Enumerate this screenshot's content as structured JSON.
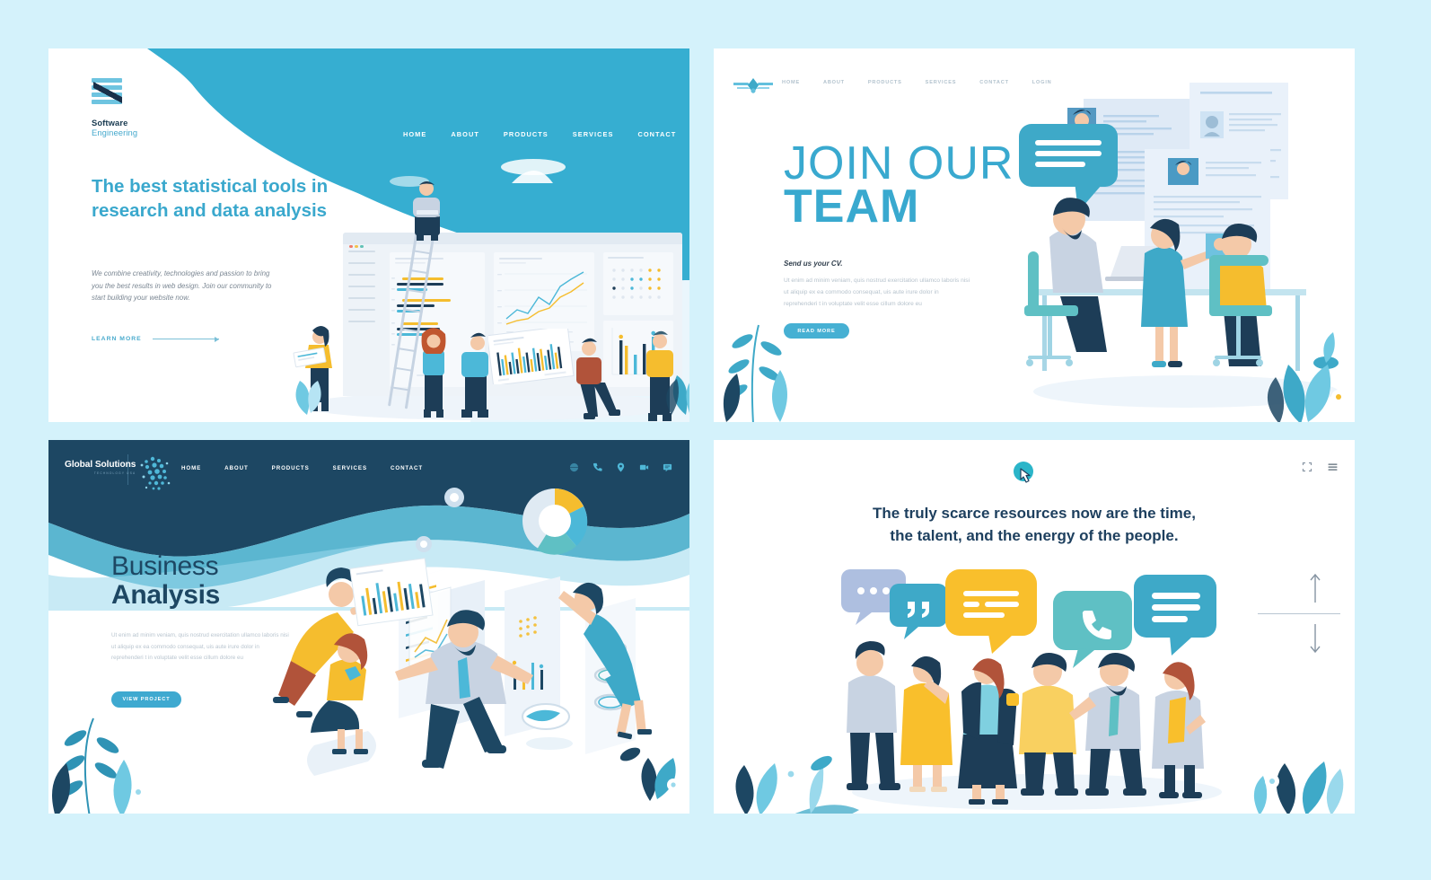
{
  "background_color": "#d4f2fb",
  "panels": [
    {
      "id": "software-engineering",
      "logo": {
        "title": "Software",
        "subtitle": "Engineering"
      },
      "nav": [
        "HOME",
        "ABOUT",
        "PRODUCTS",
        "SERVICES",
        "CONTACT"
      ],
      "menu_icon": "hamburger-icon",
      "heading": "The best statistical tools in research and data analysis",
      "body": "We combine creativity, technologies and passion to bring you the best results in web design. Join our community to start building your website now.",
      "cta": "LEARN MORE",
      "accent": "#3aa8cd",
      "hero_bg": "#36aed1"
    },
    {
      "id": "join-our-team",
      "logo": "wings-icon",
      "nav": [
        "HOME",
        "ABOUT",
        "PRODUCTS",
        "SERVICES",
        "CONTACT",
        "LOGIN"
      ],
      "heading_line1": "JOIN OUR",
      "heading_line2": "TEAM",
      "subtitle": "Send us your CV.",
      "body": "Ut enim ad minim veniam, quis nostrud exercitation ullamco laboris nisi ut aliquip ex ea commodo consequat, uis aute irure dolor in reprehenderi t in voluptate velit esse cillum dolore eu",
      "cta": "READ MORE",
      "accent": "#39a9cf"
    },
    {
      "id": "business-analysis",
      "logo": {
        "title": "Global Solutions",
        "tagline": "TECHNOLOGY USA"
      },
      "nav": [
        "HOME",
        "ABOUT",
        "PRODUCTS",
        "SERVICES",
        "CONTACT"
      ],
      "icons": [
        "globe-icon",
        "phone-icon",
        "location-pin-icon",
        "video-camera-icon",
        "message-icon"
      ],
      "heading_line1": "Business",
      "heading_line2": "Analysis",
      "body": "Ut enim ad minim veniam, quis nostrud exercitation ullamco laboris nisi ut aliquip ex ea commodo consequat, uis aute irure dolor in reprehenderi t in voluptate velit esse cillum dolore eu",
      "cta": "VIEW PROJECT",
      "accent": "#3ea9d0",
      "header_bg": "#1d4763"
    },
    {
      "id": "scarce-resources",
      "logo": "cursor-click-icon",
      "tools": [
        "fullscreen-icon",
        "hamburger-icon"
      ],
      "quote_line1": "The truly scarce resources now are the time,",
      "quote_line2": "the talent, and the energy of the people.",
      "scroll": {
        "up": "arrow-up-icon",
        "down": "arrow-down-icon"
      },
      "accent": "#1d3f5e"
    }
  ]
}
